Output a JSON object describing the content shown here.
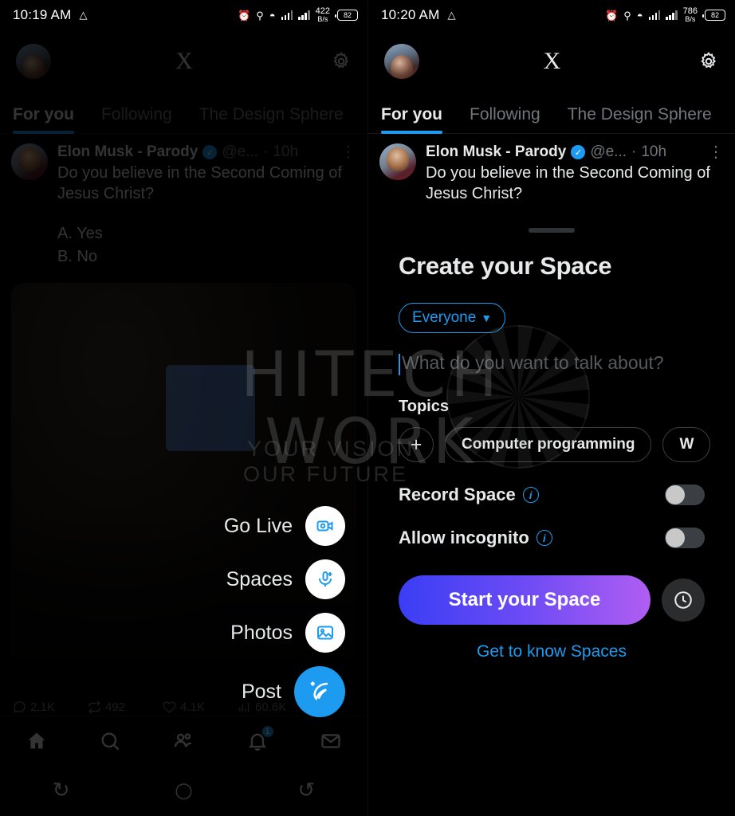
{
  "left": {
    "status": {
      "time": "10:19 AM",
      "triangle_icon": "nav-triangle-icon",
      "alarm_icon": "alarm-icon",
      "location_icon": "location-icon",
      "wifi_icon": "wifi-icon",
      "net_speed": "422",
      "net_speed_unit": "B/s",
      "battery": "82"
    },
    "header": {
      "x_logo": "X",
      "settings_icon": "gear-icon"
    },
    "tabs": [
      {
        "label": "For you",
        "active": true
      },
      {
        "label": "Following",
        "active": false
      },
      {
        "label": "The Design Sphere",
        "active": false
      }
    ],
    "tweet": {
      "name": "Elon Musk - Parody",
      "handle": "@e...",
      "time": "10h",
      "text": "Do you believe in the Second Coming of Jesus Christ?",
      "poll": "A. Yes\nB. No",
      "stats": {
        "replies": "2.1K",
        "reposts": "492",
        "likes": "4.1K",
        "views": "60.6K"
      }
    },
    "fab_menu": [
      {
        "label": "Go Live",
        "icon": "video-camera-icon"
      },
      {
        "label": "Spaces",
        "icon": "spaces-mic-icon"
      },
      {
        "label": "Photos",
        "icon": "image-icon"
      },
      {
        "label": "Post",
        "icon": "feather-quill-icon"
      }
    ],
    "bottom_nav": [
      {
        "icon": "home-icon",
        "badge": ""
      },
      {
        "icon": "search-icon",
        "badge": ""
      },
      {
        "icon": "communities-icon",
        "badge": ""
      },
      {
        "icon": "bell-icon",
        "badge": "1"
      },
      {
        "icon": "mail-icon",
        "badge": ""
      }
    ],
    "android_nav": {
      "recents": "↻",
      "home": "○",
      "back": "↺"
    }
  },
  "right": {
    "status": {
      "time": "10:20 AM",
      "net_speed": "786",
      "net_speed_unit": "B/s",
      "battery": "82"
    },
    "header": {
      "x_logo": "X",
      "settings_icon": "gear-icon"
    },
    "tabs": [
      {
        "label": "For you",
        "active": true
      },
      {
        "label": "Following",
        "active": false
      },
      {
        "label": "The Design Sphere",
        "active": false
      }
    ],
    "tweet": {
      "name": "Elon Musk - Parody",
      "handle": "@e...",
      "time": "10h",
      "text": "Do you believe in the Second Coming of Jesus Christ?"
    },
    "sheet": {
      "title": "Create your Space",
      "audience": "Everyone",
      "audience_chevron": "chevron-down-icon",
      "talk_placeholder": "What do you want to talk about?",
      "topics_label": "Topics",
      "add_chip": "+",
      "chips": [
        "Computer programming",
        "W"
      ],
      "settings": [
        {
          "label": "Record Space",
          "info": "i",
          "on": false
        },
        {
          "label": "Allow incognito",
          "info": "i",
          "on": false
        }
      ],
      "cta": "Start your Space",
      "schedule_icon": "clock-icon",
      "link": "Get to know Spaces"
    },
    "android_nav": {
      "recents": "↻",
      "home": "○",
      "back": "↺"
    }
  },
  "watermark": {
    "line1": "HITECH",
    "line2": "WORK",
    "sub1": "YOUR VISION",
    "sub2": "OUR FUTURE"
  },
  "colors": {
    "accent_blue": "#1d9bf0",
    "gradient_start": "#3a3ef5",
    "gradient_end": "#b05ef2",
    "text_primary": "#e7e9ea",
    "text_muted": "#71767b",
    "background": "#000000"
  }
}
